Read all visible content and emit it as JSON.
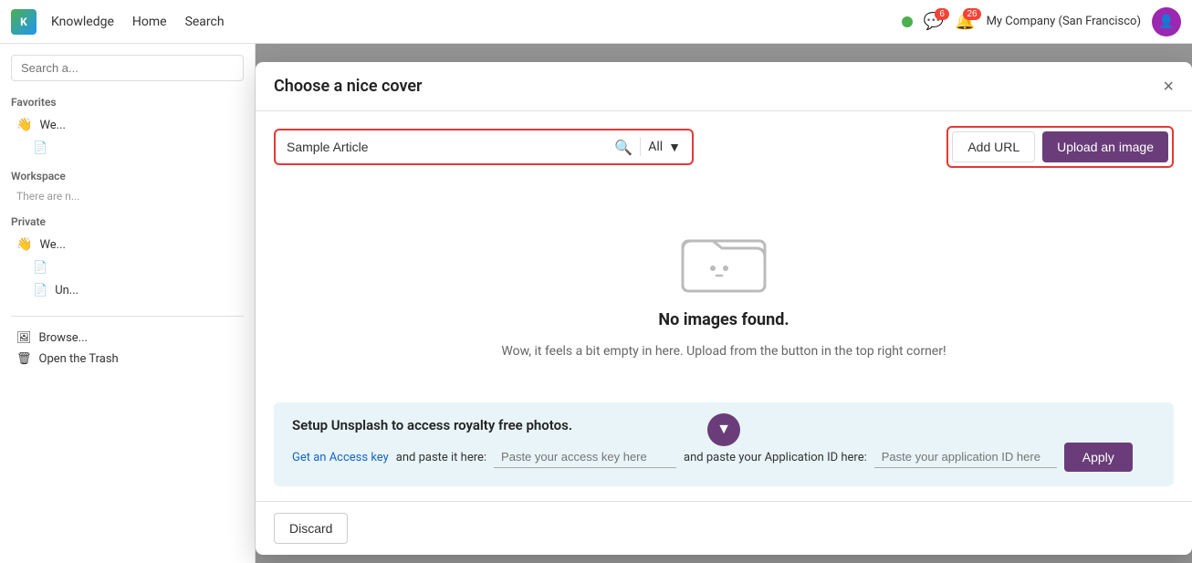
{
  "app": {
    "logo_text": "K",
    "nav": {
      "items": [
        {
          "label": "Knowledge"
        },
        {
          "label": "Home"
        },
        {
          "label": "Search"
        }
      ]
    },
    "top_bar": {
      "company": "My Company (San Francisco)",
      "badge1_count": "6",
      "badge2_count": "26"
    }
  },
  "sidebar": {
    "search_placeholder": "Search a...",
    "sections": [
      {
        "title": "Favorites",
        "items": [
          {
            "emoji": "👋",
            "label": "We..."
          },
          {
            "icon": "doc",
            "label": ""
          }
        ]
      },
      {
        "title": "Workspace",
        "subtitle": "There are n..."
      },
      {
        "title": "Private",
        "items": [
          {
            "emoji": "👋",
            "label": "We..."
          },
          {
            "icon": "doc",
            "label": ""
          },
          {
            "icon": "doc",
            "label": "Un..."
          }
        ]
      }
    ],
    "footer": [
      {
        "icon": "image",
        "label": "Browse..."
      },
      {
        "icon": "trash",
        "label": "Open the Trash"
      }
    ]
  },
  "modal": {
    "title": "Choose a nice cover",
    "close_label": "×",
    "search": {
      "value": "Sample Article",
      "filter_label": "All"
    },
    "buttons": {
      "add_url": "Add URL",
      "upload": "Upload an image"
    },
    "empty_state": {
      "title": "No images found.",
      "subtitle": "Wow, it feels a bit empty in here. Upload from the button in the top right corner!"
    },
    "unsplash": {
      "title": "Setup Unsplash to access royalty free photos.",
      "link_text": "Get an Access key",
      "link_label": "and paste it here:",
      "access_placeholder": "Paste your access key here",
      "app_id_label": "and paste your Application ID here:",
      "app_id_placeholder": "Paste your application ID here",
      "apply_label": "Apply"
    },
    "footer": {
      "discard_label": "Discard"
    }
  }
}
